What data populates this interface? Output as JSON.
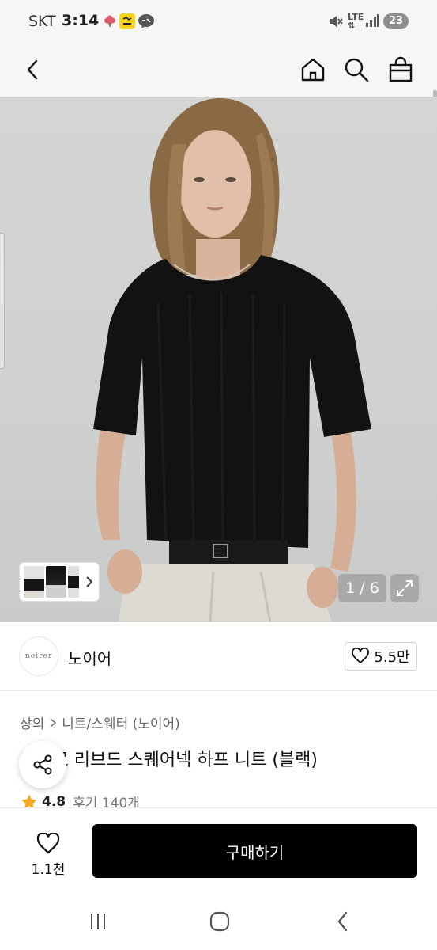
{
  "status_bar": {
    "carrier": "SKT",
    "time": "3:14",
    "network_label": "LTE",
    "battery": "23"
  },
  "nav": {
    "back_icon": "chevron-left-icon",
    "home_icon": "home-icon",
    "search_icon": "search-icon",
    "cart_icon": "shopping-bag-icon"
  },
  "gallery": {
    "counter": "1 / 6"
  },
  "brand": {
    "logo_text": "noirer",
    "name": "노이어",
    "likes": "5.5만"
  },
  "product": {
    "breadcrumb": [
      "상의",
      "니트/스웨터 (노이어)"
    ],
    "title": "마크로 리브드 스퀘어넥 하프 니트 (블랙)",
    "rating": "4.8",
    "reviews": "후기 140개"
  },
  "bottom_bar": {
    "wish_count": "1.1천",
    "buy_label": "구매하기"
  },
  "colors": {
    "accent_star": "#f5a623",
    "buy_bg": "#000000"
  }
}
